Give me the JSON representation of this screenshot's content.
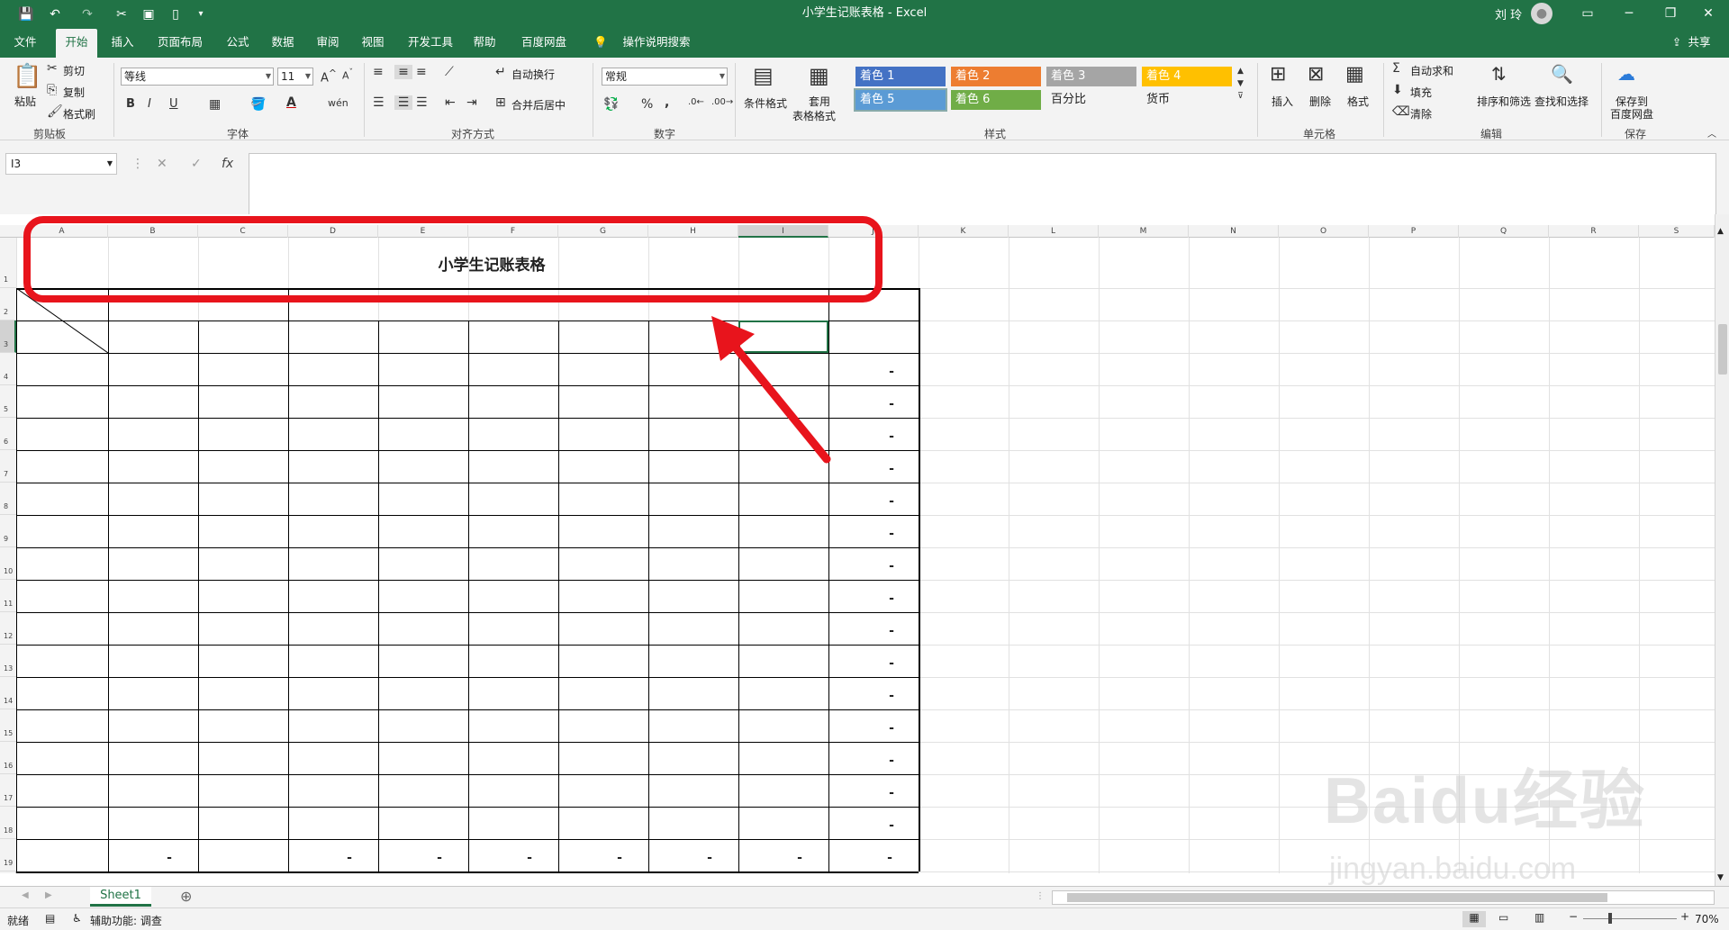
{
  "window": {
    "title": "小学生记账表格  -  Excel",
    "user": "刘 玲"
  },
  "quick_access": {
    "save": "💾",
    "undo": "↶",
    "redo": "↷"
  },
  "tabs": [
    "文件",
    "开始",
    "插入",
    "页面布局",
    "公式",
    "数据",
    "审阅",
    "视图",
    "开发工具",
    "帮助",
    "百度网盘",
    "操作说明搜索"
  ],
  "share_label": "共享",
  "ribbon": {
    "clipboard": {
      "paste": "粘贴",
      "cut": "剪切",
      "copy": "复制",
      "format_painter": "格式刷",
      "label": "剪贴板"
    },
    "font": {
      "name": "等线",
      "size": "11",
      "bold": "B",
      "italic": "I",
      "underline": "U",
      "label": "字体"
    },
    "alignment": {
      "wrap": "自动换行",
      "merge": "合并后居中",
      "label": "对齐方式"
    },
    "number": {
      "format": "常规",
      "percent": "%",
      "comma": ",",
      "label": "数字"
    },
    "styles": {
      "conditional": "条件格式",
      "table_format_1": "套用",
      "table_format_2": "表格格式",
      "cells": [
        "着色 1",
        "着色 2",
        "着色 3",
        "着色 4",
        "着色 5",
        "着色 6",
        "百分比",
        "货币"
      ],
      "colors": [
        "#4472c4",
        "#ed7d31",
        "#a5a5a5",
        "#ffc000",
        "#5b9bd5",
        "#70ad47"
      ],
      "label": "样式"
    },
    "cells_group": {
      "insert": "插入",
      "delete": "删除",
      "format": "格式",
      "label": "单元格"
    },
    "editing": {
      "autosum": "自动求和",
      "fill": "填充",
      "clear": "清除",
      "sort": "排序和筛选",
      "find": "查找和选择",
      "label": "编辑"
    },
    "save_group": {
      "save1": "保存到",
      "save2": "百度网盘",
      "label": "保存"
    }
  },
  "formula_bar": {
    "name_box": "I3",
    "cancel": "✕",
    "enter": "✓",
    "fx": "fx",
    "content": ""
  },
  "columns": [
    "A",
    "B",
    "C",
    "D",
    "E",
    "F",
    "G",
    "H",
    "I",
    "J",
    "K",
    "L",
    "M",
    "N",
    "O",
    "P",
    "Q",
    "R",
    "S"
  ],
  "rows": [
    "1",
    "2",
    "3",
    "4",
    "5",
    "6",
    "7",
    "8",
    "9",
    "10",
    "11",
    "12",
    "13",
    "14",
    "15",
    "16",
    "17",
    "18",
    "19"
  ],
  "sheet": {
    "title": "小学生记账表格",
    "dash": "-"
  },
  "sheet_tabs": [
    "Sheet1"
  ],
  "add_sheet": "⊕",
  "status": {
    "ready": "就绪",
    "accessibility": "辅助功能: 调查",
    "zoom": "70%"
  },
  "watermark": {
    "line1": "Baidu经验",
    "line2": "jingyan.baidu.com"
  }
}
